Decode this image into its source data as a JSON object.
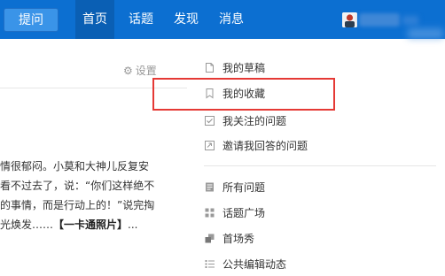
{
  "navbar": {
    "ask_label": "提问",
    "items": [
      {
        "label": "首页"
      },
      {
        "label": "话题"
      },
      {
        "label": "发现"
      },
      {
        "label": "消息"
      }
    ]
  },
  "settings": {
    "label": "设置"
  },
  "feed": {
    "lines": [
      "情很郁闷。小莫和大神儿反复安",
      "看不过去了，说：“你们这样绝不",
      "的事情，而是行动上的！”说完掏",
      "光焕发……",
      "【一卡通照片】",
      "..."
    ]
  },
  "dropdown": {
    "items": [
      {
        "label": "我的草稿",
        "icon": "draft-icon"
      },
      {
        "label": "我的收藏",
        "icon": "bookmark-icon"
      },
      {
        "label": "我关注的问题",
        "icon": "checkbox-icon"
      },
      {
        "label": "邀请我回答的问题",
        "icon": "invite-icon"
      },
      {
        "label": "所有问题",
        "icon": "document-list-icon"
      },
      {
        "label": "话题广场",
        "icon": "grid-icon"
      },
      {
        "label": "首场秀",
        "icon": "showcase-icon"
      },
      {
        "label": "公共编辑动态",
        "icon": "list-icon"
      }
    ]
  },
  "colors": {
    "navbar": "#0c6fd1",
    "highlight": "#e53935"
  }
}
